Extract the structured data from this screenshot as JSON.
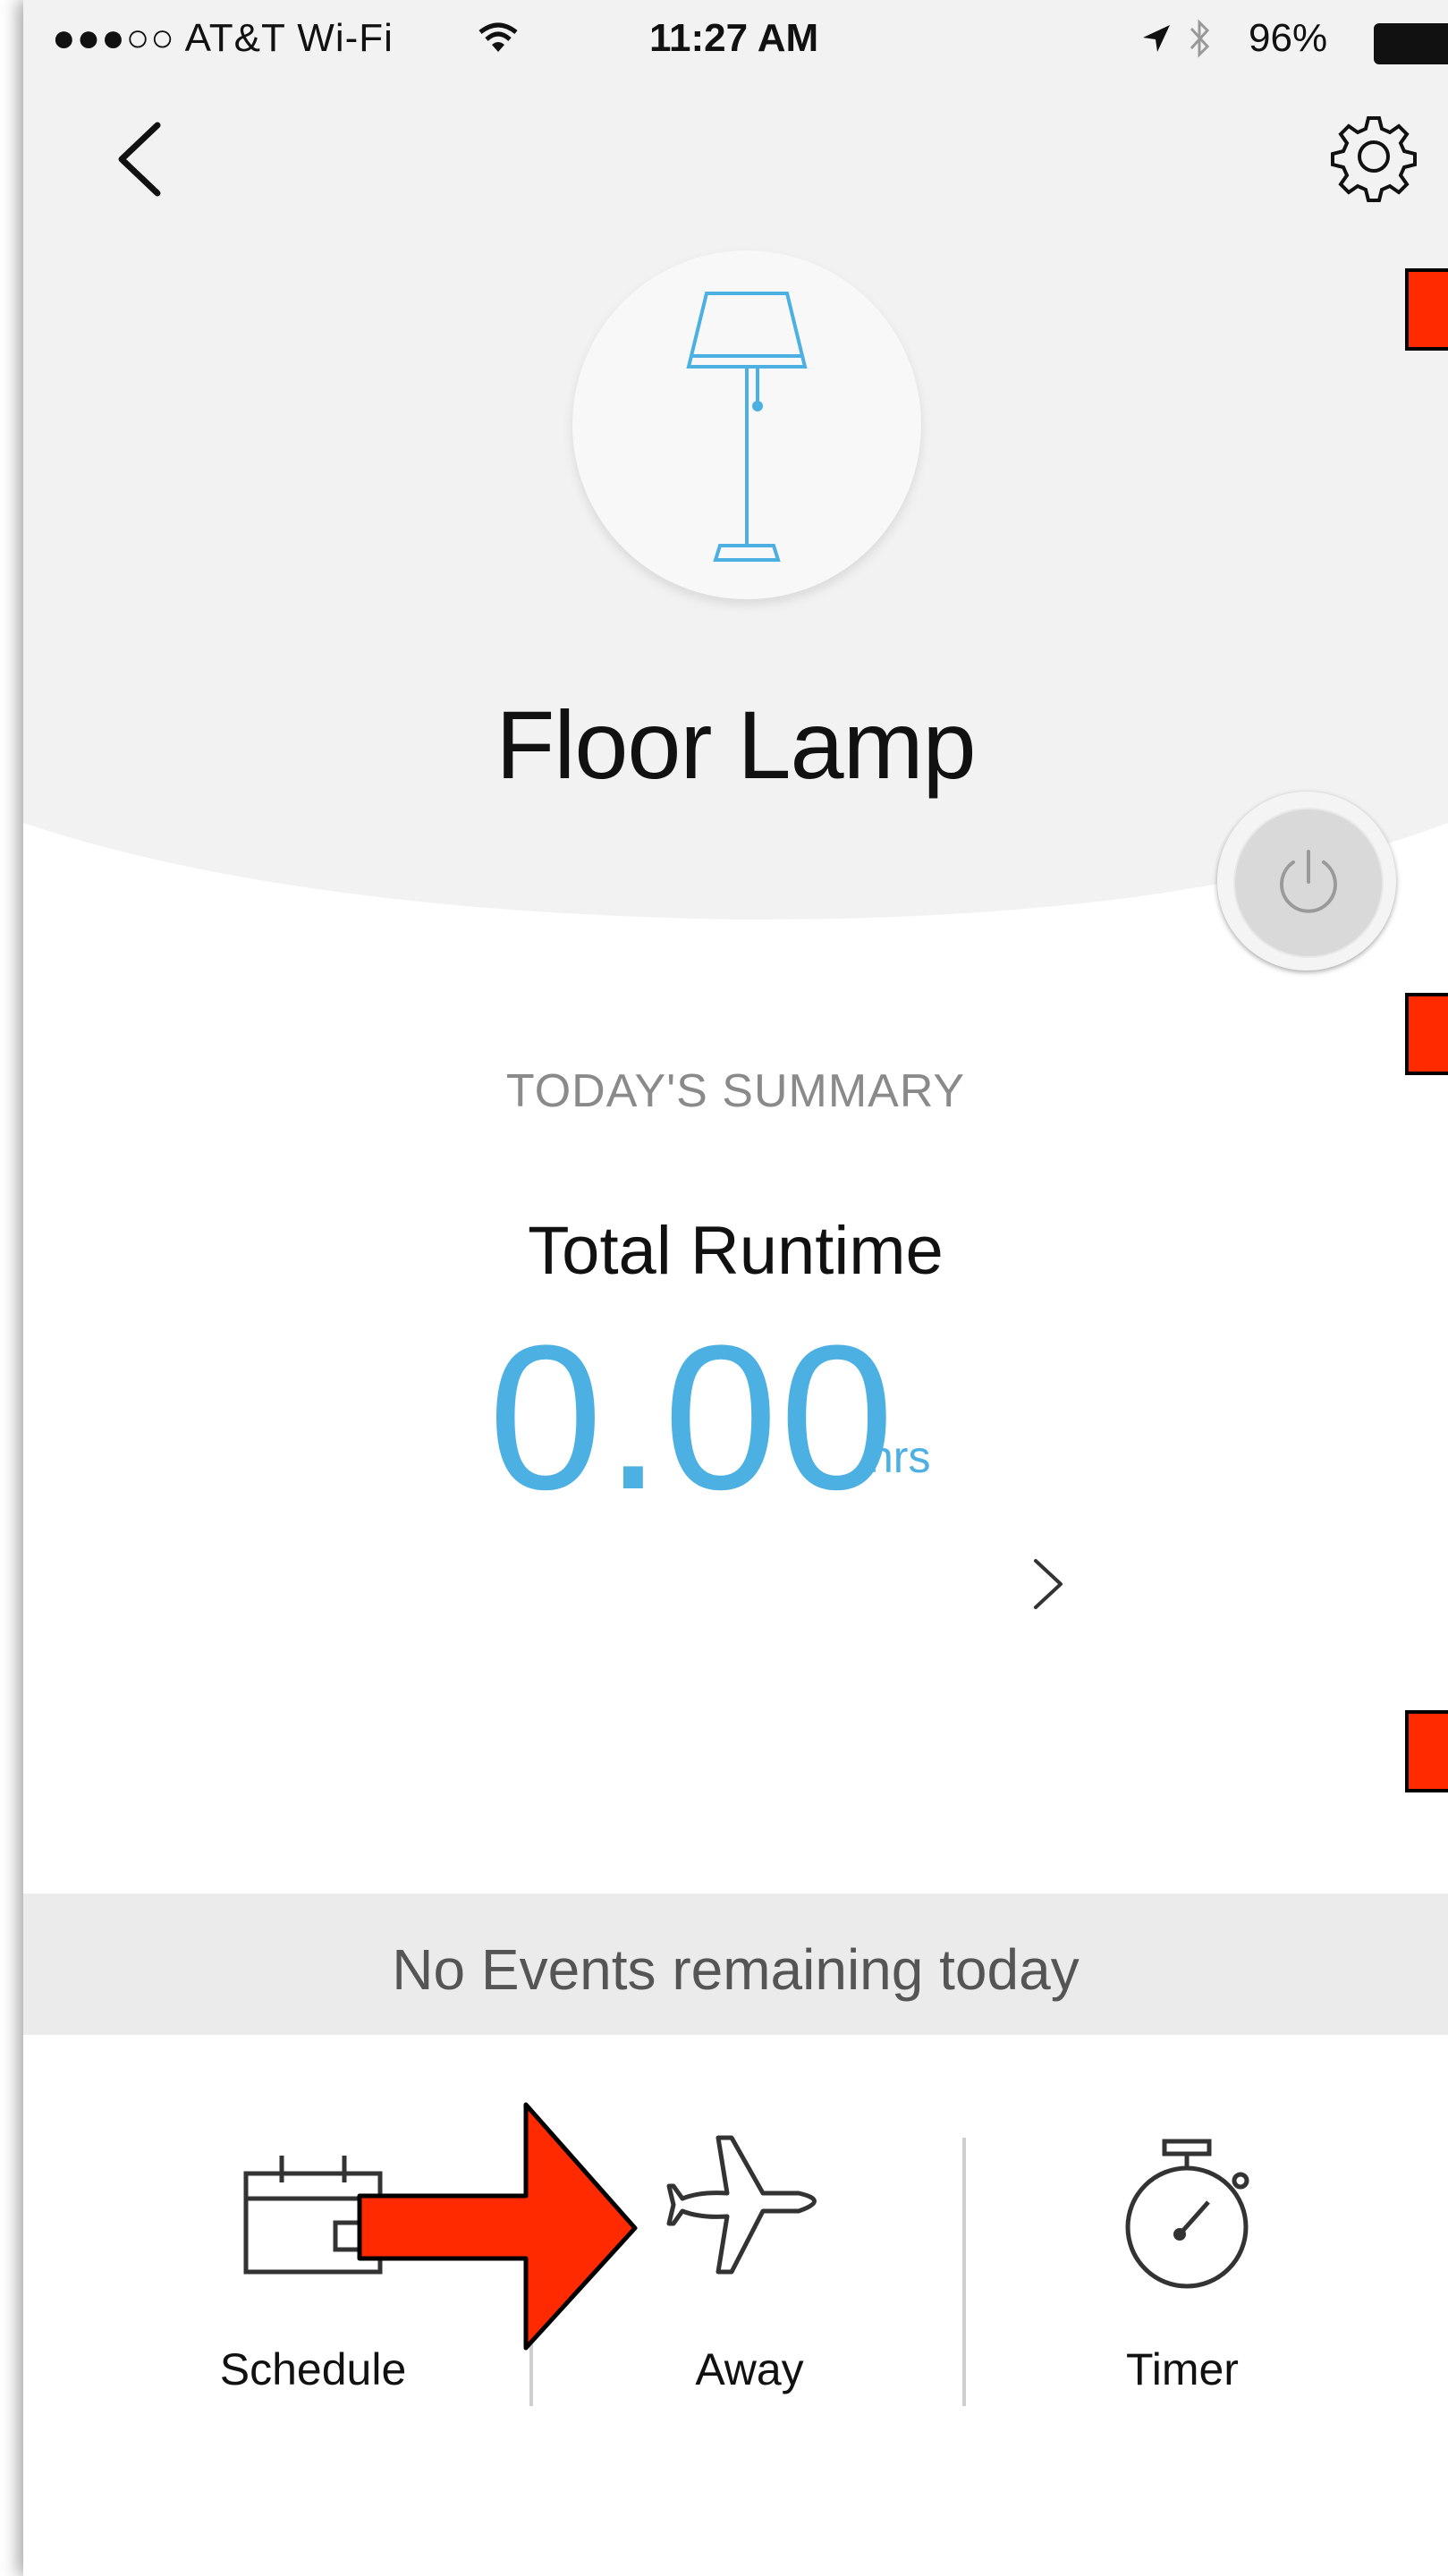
{
  "status_bar": {
    "carrier": "●●●○○ AT&T Wi-Fi",
    "time": "11:27 AM",
    "battery": "96%"
  },
  "nav": {
    "back_icon": "chevron-left-icon",
    "settings_icon": "gear-icon"
  },
  "device": {
    "name": "Floor Lamp",
    "icon": "floor-lamp-icon"
  },
  "summary": {
    "heading": "TODAY'S SUMMARY",
    "runtime_label": "Total Runtime",
    "runtime_value": "0.00",
    "runtime_unit": "hrs"
  },
  "events": {
    "text": "No Events remaining today"
  },
  "tabs": [
    {
      "label": "Schedule",
      "icon": "calendar-icon"
    },
    {
      "label": "Away",
      "icon": "airplane-icon"
    },
    {
      "label": "Timer",
      "icon": "stopwatch-icon"
    }
  ],
  "colors": {
    "accent": "#4db0e3",
    "header_bg": "#f2f2f2",
    "annotation": "#ff2a00"
  }
}
